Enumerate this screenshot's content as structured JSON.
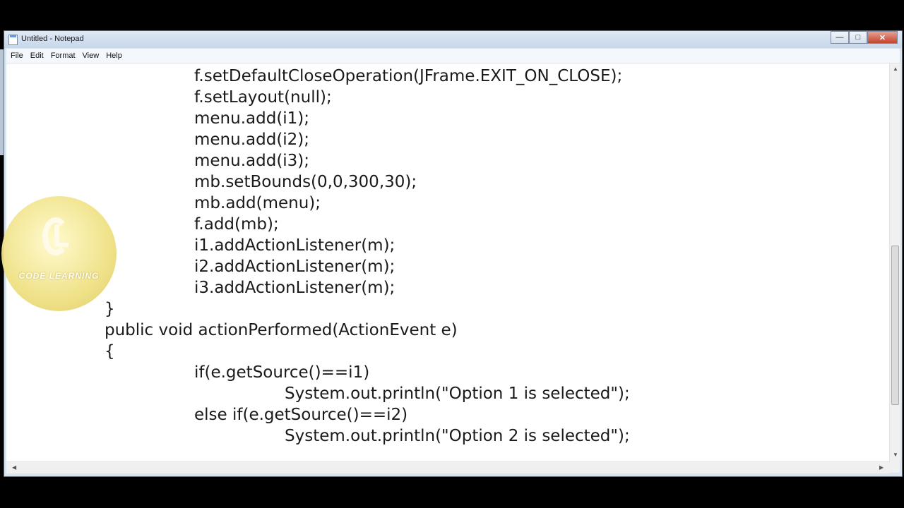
{
  "window": {
    "title": "Untitled - Notepad"
  },
  "menu": {
    "file": "File",
    "edit": "Edit",
    "format": "Format",
    "view": "View",
    "help": "Help"
  },
  "code_lines": [
    "f.setDefaultCloseOperation(JFrame.EXIT_ON_CLOSE);",
    "f.setLayout(null);",
    "menu.add(i1);",
    "menu.add(i2);",
    "menu.add(i3);",
    "mb.setBounds(0,0,300,30);",
    "mb.add(menu);",
    "f.add(mb);",
    "i1.addActionListener(m);",
    "i2.addActionListener(m);",
    "i3.addActionListener(m);",
    "}",
    "public void actionPerformed(ActionEvent e)",
    "{",
    "if(e.getSource()==i1)",
    "System.out.println(\"Option 1 is selected\");",
    "else if(e.getSource()==i2)",
    "System.out.println(\"Option 2 is selected\");"
  ],
  "watermark": {
    "text": "CODE LEARNING"
  },
  "icons": {
    "app": "notepad-icon",
    "minimize": "minimize-icon",
    "maximize": "maximize-icon",
    "close": "close-icon",
    "scroll_up": "scroll-up-arrow-icon",
    "scroll_down": "scroll-down-arrow-icon",
    "scroll_left": "scroll-left-arrow-icon",
    "scroll_right": "scroll-right-arrow-icon"
  },
  "colors": {
    "close_button": "#c3432b",
    "titlebar": "#c7d6ea",
    "watermark": "#eee082"
  }
}
